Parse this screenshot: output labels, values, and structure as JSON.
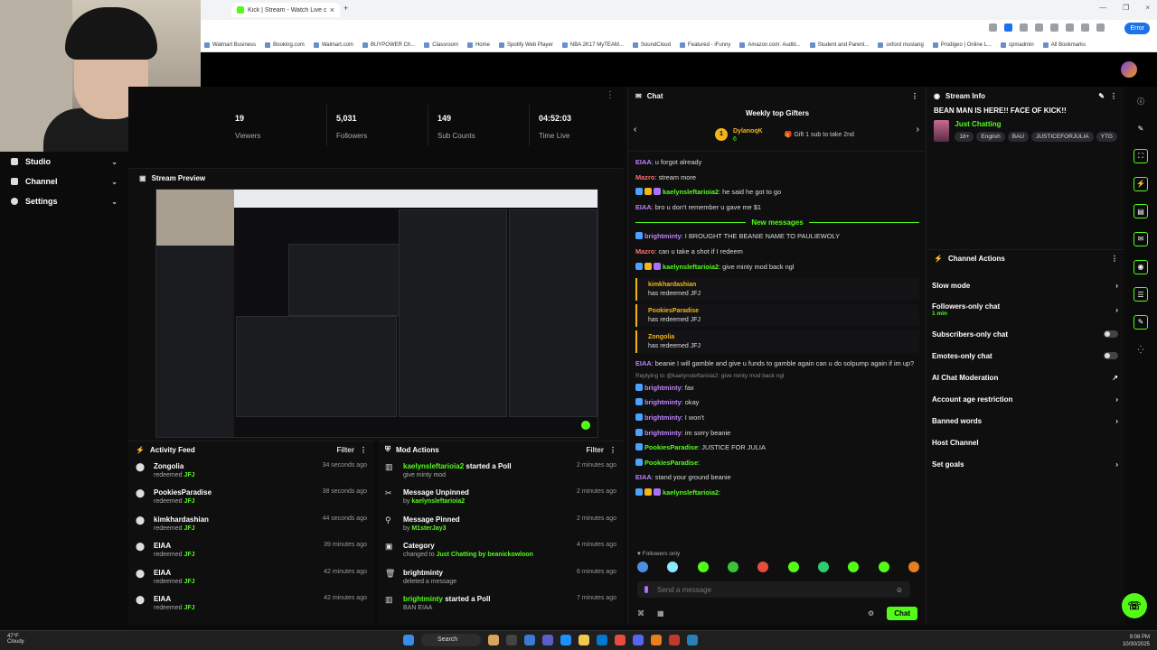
{
  "browser": {
    "tab_title": "Kick | Stream - Watch Live on K",
    "tab_close": "×",
    "new_tab": "+",
    "window_controls": [
      "—",
      "❐",
      "×"
    ],
    "profile_label": "Error",
    "bookmarks": [
      "Walmart Business",
      "Booking.com",
      "Walmart.com",
      "BUYPOWER Ch...",
      "Classroom",
      "Home",
      "Spotify Web Player",
      "NBA 2K17 MyTEAM...",
      "SoundCloud",
      "Featured - iFunny",
      "Amazon.com: Audib...",
      "Student and Parent...",
      "oxford mustang",
      "Prodigeo | Online L...",
      "cpmadmin",
      "All Bookmarks"
    ]
  },
  "sidebar": {
    "items": [
      {
        "label": "Studio",
        "icon": "studio-icon"
      },
      {
        "label": "Channel",
        "icon": "channel-icon"
      },
      {
        "label": "Settings",
        "icon": "gear-icon"
      }
    ]
  },
  "stats": [
    {
      "value": "19",
      "label": "Viewers"
    },
    {
      "value": "5,031",
      "label": "Followers"
    },
    {
      "value": "149",
      "label": "Sub Counts"
    },
    {
      "value": "04:52:03",
      "label": "Time Live"
    }
  ],
  "preview": {
    "title": "Stream Preview"
  },
  "activity_feed": {
    "title": "Activity Feed",
    "filter": "Filter",
    "items": [
      {
        "name": "Zongolia",
        "action": "redeemed",
        "reward": "JFJ",
        "time": "34 seconds ago"
      },
      {
        "name": "PookiesParadise",
        "action": "redeemed",
        "reward": "JFJ",
        "time": "38 seconds ago"
      },
      {
        "name": "kimkhardashian",
        "action": "redeemed",
        "reward": "JFJ",
        "time": "44 seconds ago"
      },
      {
        "name": "EIAA",
        "action": "redeemed",
        "reward": "JFJ",
        "time": "39 minutes ago"
      },
      {
        "name": "EIAA",
        "action": "redeemed",
        "reward": "JFJ",
        "time": "42 minutes ago"
      },
      {
        "name": "EIAA",
        "action": "redeemed",
        "reward": "JFJ",
        "time": "42 minutes ago"
      }
    ]
  },
  "mod_actions": {
    "title": "Mod Actions",
    "filter": "Filter",
    "items": [
      {
        "icon": "poll-icon",
        "name": "kaelynsleftarioia2",
        "name_green": true,
        "title_rest": " started a Poll",
        "sub": "give minty mod",
        "sub_green": "",
        "time": "2 minutes ago"
      },
      {
        "icon": "unpin-icon",
        "name": "Message Unpinned",
        "name_green": false,
        "title_rest": "",
        "sub": "by ",
        "sub_green": "kaelynsleftarioia2",
        "time": "2 minutes ago"
      },
      {
        "icon": "pin-icon",
        "name": "Message Pinned",
        "name_green": false,
        "title_rest": "",
        "sub": "by ",
        "sub_green": "M1sterJay3",
        "time": "2 minutes ago"
      },
      {
        "icon": "category-icon",
        "name": "Category",
        "name_green": false,
        "title_rest": "",
        "sub": "changed to ",
        "sub_green": "Just Chatting by beanickowloon",
        "time": "4 minutes ago"
      },
      {
        "icon": "trash-icon",
        "name": "brightminty",
        "name_green": false,
        "title_rest": "",
        "sub": "deleted a message",
        "sub_green": "",
        "time": "6 minutes ago"
      },
      {
        "icon": "poll-icon",
        "name": "brightminty",
        "name_green": true,
        "title_rest": " started a Poll",
        "sub": "BAN EIAA",
        "sub_green": "",
        "time": "7 minutes ago"
      }
    ]
  },
  "chat": {
    "title": "Chat",
    "gifters_title": "Weekly top Gifters",
    "gifter": {
      "rank": "1",
      "name": "DylanoqK",
      "count": "6"
    },
    "gift_hint": "Gift 1 sub to take 2nd",
    "new_messages_label": "New messages",
    "messages_before": [
      {
        "user": "EIAA",
        "color": "#c084fc",
        "badges": [],
        "text": "u forgot already"
      },
      {
        "user": "Mazro",
        "color": "#f87171",
        "badges": [],
        "text": "stream more"
      },
      {
        "user": "kaelynsleftarioia2",
        "color": "#53fc18",
        "badges": [
          "#4aa3ff",
          "#f3b41b",
          "#a970ff"
        ],
        "text": "he said he got to go"
      },
      {
        "user": "EIAA",
        "color": "#c084fc",
        "badges": [],
        "text": "bro u don't remember u gave me $1"
      }
    ],
    "messages_after": [
      {
        "user": "brightminty",
        "color": "#c084fc",
        "badges": [
          "#4aa3ff"
        ],
        "text": "I BROUGHT THE BEANIE NAME TO PAULIEWOLY"
      },
      {
        "user": "Mazro",
        "color": "#f87171",
        "badges": [],
        "text": "can u take a shot if I redeem"
      },
      {
        "user": "kaelynsleftarioia2",
        "color": "#53fc18",
        "badges": [
          "#4aa3ff",
          "#f3b41b",
          "#a970ff"
        ],
        "text": "give minty mod back ngl"
      }
    ],
    "redeems": [
      {
        "name": "kimkhardashian",
        "text": "has redeemed JFJ"
      },
      {
        "name": "PookiesParadise",
        "text": "has redeemed JFJ"
      },
      {
        "name": "Zongolia",
        "text": "has redeemed JFJ"
      }
    ],
    "messages_tail_first": {
      "user": "EIAA",
      "color": "#c084fc",
      "text": "beanie I will gamble and give u funds to gamble again can u do solpump again if im up?"
    },
    "reply_line": "Replying to @kaelynsleftarioia2: give minty mod back ngl",
    "messages_tail": [
      {
        "user": "brightminty",
        "color": "#c084fc",
        "badges": [
          "#4aa3ff"
        ],
        "text": "fax"
      },
      {
        "user": "brightminty",
        "color": "#c084fc",
        "badges": [
          "#4aa3ff"
        ],
        "text": "okay"
      },
      {
        "user": "brightminty",
        "color": "#c084fc",
        "badges": [
          "#4aa3ff"
        ],
        "text": "I won't"
      },
      {
        "user": "brightminty",
        "color": "#c084fc",
        "badges": [
          "#4aa3ff"
        ],
        "text": "im sorry beanie"
      },
      {
        "user": "PookiesParadise",
        "color": "#53fc18",
        "badges": [
          "#4aa3ff"
        ],
        "text": "JUSTICE FOR JULIA"
      },
      {
        "user": "PookiesParadise",
        "color": "#53fc18",
        "badges": [
          "#4aa3ff"
        ],
        "text": ""
      },
      {
        "user": "EIAA",
        "color": "#c084fc",
        "badges": [],
        "text": "stand your ground beanie"
      },
      {
        "user": "kaelynsleftarioia2",
        "color": "#53fc18",
        "badges": [
          "#4aa3ff",
          "#f3b41b",
          "#a970ff"
        ],
        "text": ""
      }
    ],
    "followers_only": "Followers only",
    "emote_colors": [
      "#4a90e2",
      "#8be9fd",
      "#53fc18",
      "#3ac43a",
      "#e74c3c",
      "#53fc18",
      "#2ecc71",
      "#53fc18",
      "#53fc18",
      "#e67e22"
    ],
    "send_placeholder": "Send a message",
    "chat_button": "Chat"
  },
  "stream_info": {
    "title": "Stream Info",
    "stream_title": "BEAN MAN IS HERE!! FACE OF KICK!!",
    "category": "Just Chatting",
    "tags": [
      "18+",
      "English",
      "BAU",
      "JUSTICEFORJULIA",
      "YTG"
    ]
  },
  "channel_actions": {
    "title": "Channel Actions",
    "items": [
      {
        "label": "Slow mode",
        "sub": "",
        "control": "chevron"
      },
      {
        "label": "Followers-only chat",
        "sub": "1 min",
        "control": "chevron"
      },
      {
        "label": "Subscribers-only chat",
        "sub": "",
        "control": "toggle"
      },
      {
        "label": "Emotes-only chat",
        "sub": "",
        "control": "toggle"
      },
      {
        "label": "AI Chat Moderation",
        "sub": "",
        "control": "external"
      },
      {
        "label": "Account age restriction",
        "sub": "",
        "control": "chevron"
      },
      {
        "label": "Banned words",
        "sub": "",
        "control": "chevron"
      },
      {
        "label": "Host Channel",
        "sub": "",
        "control": "none"
      },
      {
        "label": "Set goals",
        "sub": "",
        "control": "chevron"
      }
    ]
  },
  "taskbar": {
    "search": "Search",
    "weather_temp": "47°F",
    "weather_desc": "Cloudy",
    "time": "9:08 PM",
    "date": "10/30/2025"
  },
  "colors": {
    "accent": "#53fc18",
    "background": "#0b0b0c",
    "panel": "#0f0f10",
    "gold": "#f3b41b"
  }
}
